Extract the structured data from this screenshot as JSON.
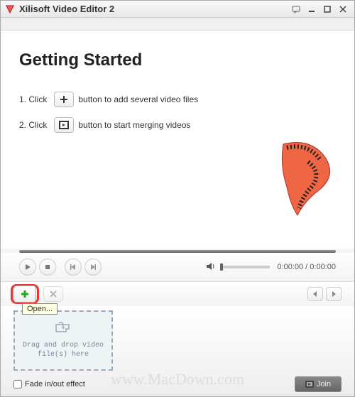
{
  "window": {
    "title": "Xilisoft Video Editor 2"
  },
  "content": {
    "heading": "Getting Started",
    "step1_num": "1. Click",
    "step1_text": "button to add several video files",
    "step2_num": "2. Click",
    "step2_text": "button to start merging videos"
  },
  "playback": {
    "time_current": "0:00:00",
    "time_sep": " / ",
    "time_total": "0:00:00"
  },
  "toolbar": {
    "add_tooltip": "Open..."
  },
  "dropzone": {
    "line1": "Drag and drop video",
    "line2": "file(s) here"
  },
  "bottom": {
    "fade_label": "Fade in/out effect",
    "join_label": "Join"
  },
  "watermark": "www.MacDown.com"
}
